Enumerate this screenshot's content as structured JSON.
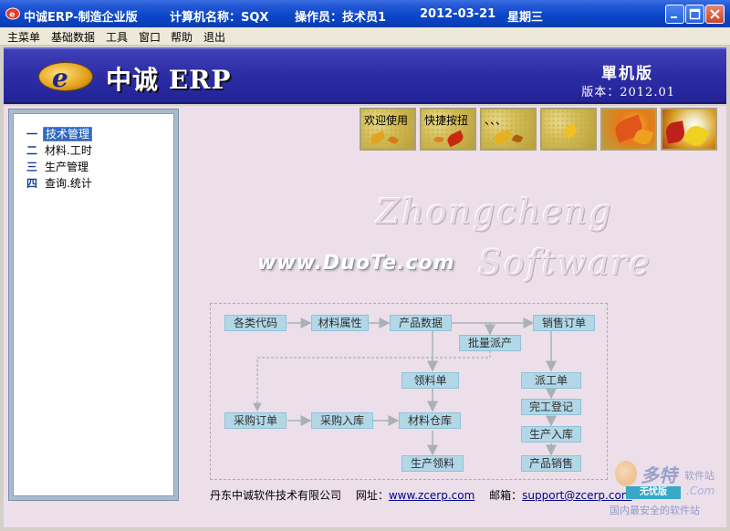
{
  "window": {
    "app_title": "中诚ERP-制造企业版",
    "computer_label": "计算机名称：SQX",
    "operator_label": "操作员：技术员1",
    "date": "2012-03-21",
    "weekday": "星期三"
  },
  "menu": [
    "主菜单",
    "基础数据",
    "工具",
    "窗口",
    "帮助",
    "退出"
  ],
  "banner": {
    "logo_letter": "e",
    "brand": "中诚 ERP",
    "edition": "單机版",
    "version": "版本：2012.01"
  },
  "tree": [
    {
      "num": "一",
      "label": "技术管理",
      "selected": true
    },
    {
      "num": "二",
      "label": "材料.工时"
    },
    {
      "num": "三",
      "label": "生产管理"
    },
    {
      "num": "四",
      "label": "查询.统计"
    }
  ],
  "tiles": [
    "欢迎使用",
    "快捷按扭",
    "、、、",
    "",
    "",
    ""
  ],
  "watermark": {
    "line1": "Zhongcheng",
    "line2": "Software",
    "site": "www.DuoTe.com"
  },
  "flow": {
    "codes": "各类代码",
    "material_attr": "材料属性",
    "product_data": "产品数据",
    "sales_order": "销售订单",
    "batch_dispatch": "批量派产",
    "pick_slip": "领料单",
    "dispatch_slip": "派工单",
    "purchase_order": "采购订单",
    "purchase_in": "采购入库",
    "material_store": "材料仓库",
    "finish_register": "完工登记",
    "production_in": "生产入库",
    "production_pick": "生产领料",
    "product_sales": "产品销售"
  },
  "footer": {
    "company": "丹东中诚软件技术有限公司",
    "site_label": "网址：",
    "site_url": "www.zcerp.com",
    "mail_label": "邮箱：",
    "mail": "support@zcerp.com"
  },
  "corner_watermark": {
    "big": "多特",
    "small": "软件站",
    "ver": "无忧版",
    "com": ".Com",
    "tag": "国内最安全的软件站"
  },
  "colors": {
    "titlebar": "#0a46c8",
    "banner": "#2c2ca6",
    "main_bg": "#ecdfea",
    "node_fill": "#b2d8e8",
    "arrow": "#aab0b8"
  }
}
